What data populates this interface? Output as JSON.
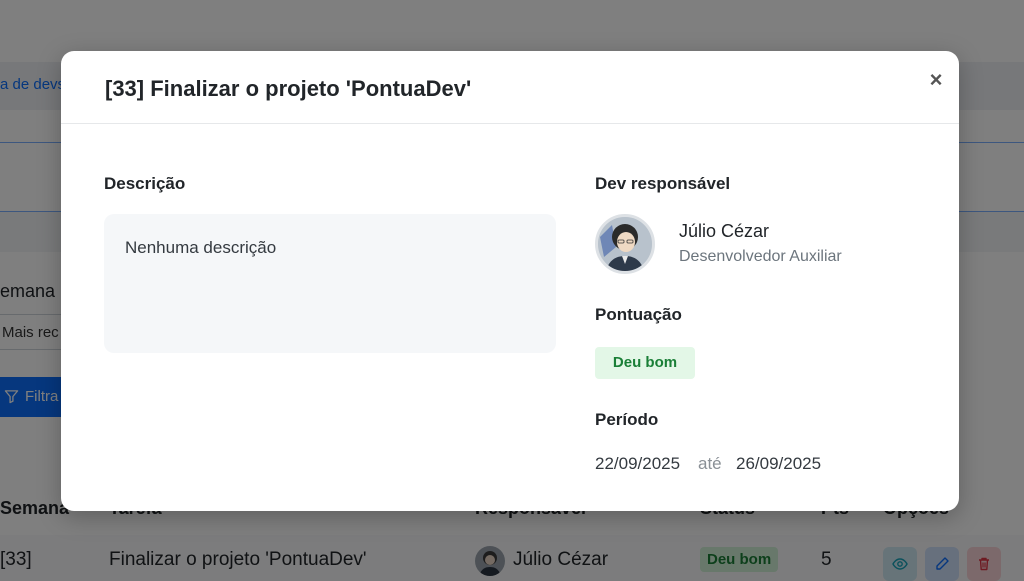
{
  "background": {
    "link_text": "a de devs",
    "semana_label": "emana",
    "sort_text": "Mais rec",
    "filter_label": "Filtra",
    "table": {
      "headers": [
        "Semana",
        "Tarefa",
        "Responsável",
        "Status",
        "Pts",
        "Opções"
      ],
      "row": {
        "semana": "[33]",
        "tarefa": "Finalizar o projeto 'PontuaDev'",
        "responsavel": "Júlio Cézar",
        "status": "Deu bom",
        "pts": "5"
      }
    }
  },
  "modal": {
    "title": "[33] Finalizar o projeto 'PontuaDev'",
    "close_label": "×",
    "description": {
      "label": "Descrição",
      "text": "Nenhuma descrição"
    },
    "dev": {
      "label": "Dev responsável",
      "name": "Júlio Cézar",
      "role": "Desenvolvedor Auxiliar"
    },
    "score": {
      "label": "Pontuação",
      "badge": "Deu bom"
    },
    "period": {
      "label": "Período",
      "start": "22/09/2025",
      "separator": "até",
      "end": "26/09/2025"
    }
  },
  "colors": {
    "primary": "#0d6efd",
    "success_text": "#1a7f37",
    "success_bg": "#e3f7e7",
    "overlay": "rgba(0,0,0,0.5)"
  },
  "icons": [
    "filter-icon",
    "eye-icon",
    "pencil-icon",
    "trash-icon",
    "close-icon"
  ]
}
